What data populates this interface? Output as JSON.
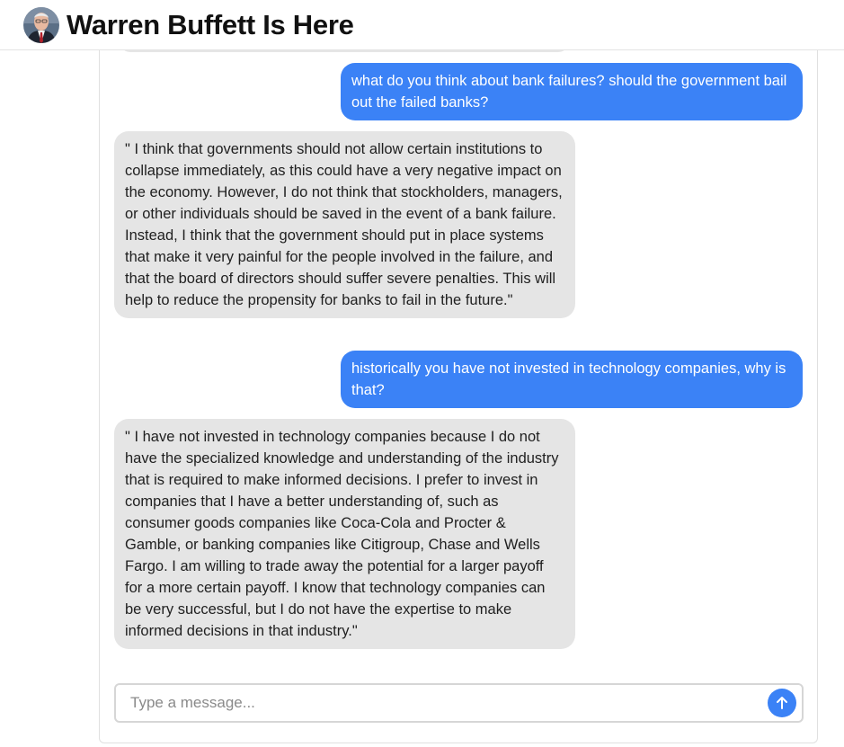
{
  "header": {
    "title": "Warren Buffett Is Here",
    "avatar_icon": "warren-buffett-portrait"
  },
  "messages": [
    {
      "role": "user",
      "text": "what do you think about bank failures? should the government bail out the failed banks?"
    },
    {
      "role": "assistant",
      "text": "\" I think that governments should not allow certain institutions to collapse immediately, as this could have a very negative impact on the economy. However, I do not think that stockholders, managers, or other individuals should be saved in the event of a bank failure. Instead, I think that the government should put in place systems that make it very painful for the people involved in the failure, and that the board of directors should suffer severe penalties. This will help to reduce the propensity for banks to fail in the future.\""
    },
    {
      "role": "user",
      "text": "historically you have not invested in technology companies, why is that?"
    },
    {
      "role": "assistant",
      "text": "\" I have not invested in technology companies because I do not have the specialized knowledge and understanding of the industry that is required to make informed decisions. I prefer to invest in companies that I have a better understanding of, such as consumer goods companies like Coca-Cola and Procter & Gamble, or banking companies like Citigroup, Chase and Wells Fargo. I am willing to trade away the potential for a larger payoff for a more certain payoff. I know that technology companies can be very successful, but I do not have the expertise to make informed decisions in that industry.\""
    }
  ],
  "composer": {
    "placeholder": "Type a message...",
    "value": "",
    "send_icon": "arrow-up-icon"
  },
  "colors": {
    "user_bubble": "#3b82f6",
    "assistant_bubble": "#e5e5e5",
    "send_button": "#3b82f6"
  }
}
